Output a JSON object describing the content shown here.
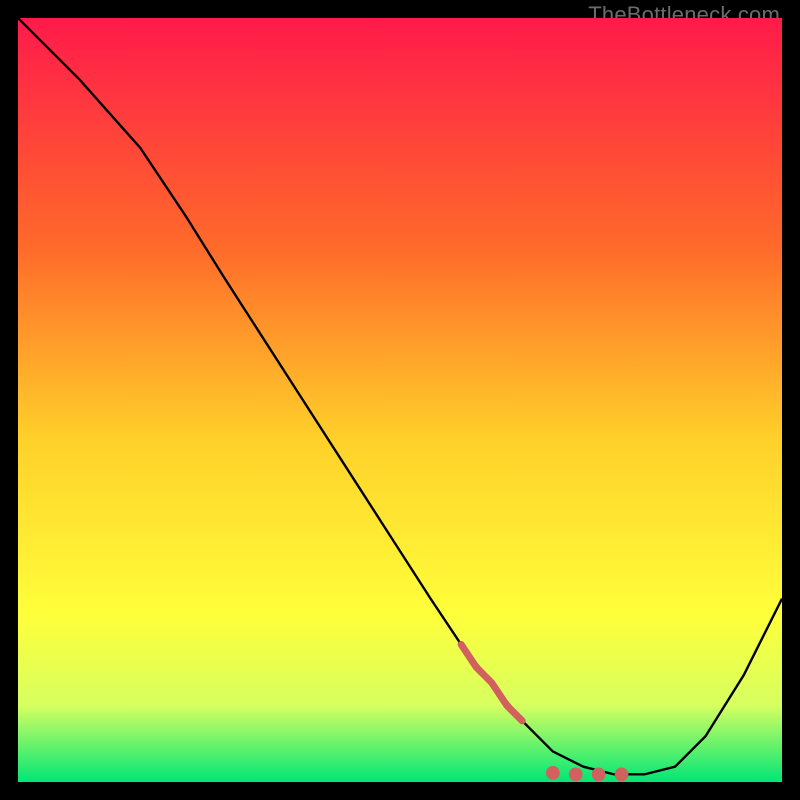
{
  "watermark": "TheBottleneck.com",
  "colors": {
    "gradient_top": "#ff1a4b",
    "gradient_mid_upper": "#ff6a2a",
    "gradient_mid": "#ffd02a",
    "gradient_mid_lower": "#ffff3a",
    "gradient_lower": "#d6ff60",
    "gradient_bottom": "#00e676",
    "curve": "#000000",
    "points": "#d1605e",
    "frame": "#000000"
  },
  "chart_data": {
    "type": "line",
    "title": "",
    "xlabel": "",
    "ylabel": "",
    "xlim": [
      0,
      100
    ],
    "ylim": [
      0,
      100
    ],
    "grid": false,
    "curve": {
      "x": [
        0,
        8,
        16,
        22,
        27,
        36,
        45,
        54,
        58,
        62,
        66,
        70,
        74,
        78,
        82,
        86,
        90,
        95,
        100
      ],
      "y": [
        100,
        92,
        83,
        74,
        66,
        52,
        38,
        24,
        18,
        13,
        8,
        4,
        2,
        1,
        1,
        2,
        6,
        14,
        24
      ]
    },
    "highlight_segment": {
      "x": [
        58,
        60,
        62,
        64,
        66
      ],
      "y": [
        18,
        15,
        13,
        10,
        8
      ]
    },
    "highlight_points": {
      "x": [
        70,
        73,
        76,
        79
      ],
      "y": [
        1.2,
        1.0,
        1.0,
        1.0
      ]
    }
  }
}
